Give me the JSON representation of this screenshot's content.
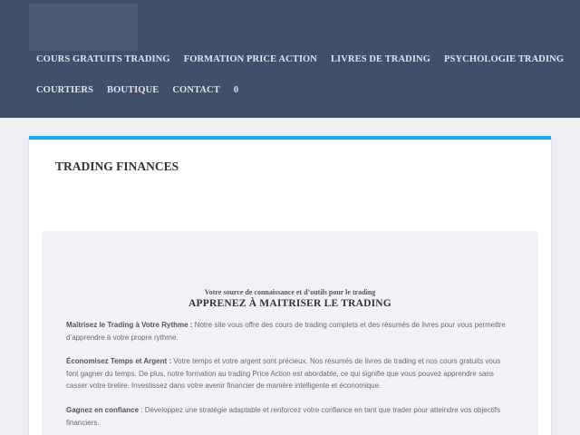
{
  "nav": {
    "row1": [
      "COURS GRATUITS TRADING",
      "FORMATION PRICE ACTION",
      "LIVRES DE TRADING",
      "PSYCHOLOGIE TRADING"
    ],
    "row2": [
      "COURTIERS",
      "BOUTIQUE",
      "CONTACT",
      "0"
    ]
  },
  "card": {
    "title": "TRADING FINANCES"
  },
  "panel": {
    "tagline": "Votre source de connaissance et d’outils pour le trading",
    "headline": "APPRENEZ À MAITRISER LE TRADING",
    "paragraphs": [
      {
        "lead": "Maîtrisez le Trading à Votre Rythme :",
        "text": " Notre site vous offre des cours de trading complets et des résumés de livres pour vous permettre d’apprendre à votre propre rythme."
      },
      {
        "lead": "Économisez Temps et Argent :",
        "text": " Votre temps et votre argent sont précieux. Nos résumés de livres de trading et nos cours gratuits vous font gagner du temps. De plus, notre formation au trading Price Action est abordable, ce qui signifie que vous pouvez apprendre sans casser votre tirelire. Investissez dans votre avenir financier de manière intelligente et économique."
      },
      {
        "lead": "Gagnez en confiance",
        "text": " : Développez une stratégie adaptable et renforcez votre confiance en tant que trader pour atteindre vos objectifs financiers."
      }
    ]
  },
  "colors": {
    "header_bg": "#3f5068",
    "accent": "#1ea5f0",
    "page_bg": "#eef0f4"
  }
}
